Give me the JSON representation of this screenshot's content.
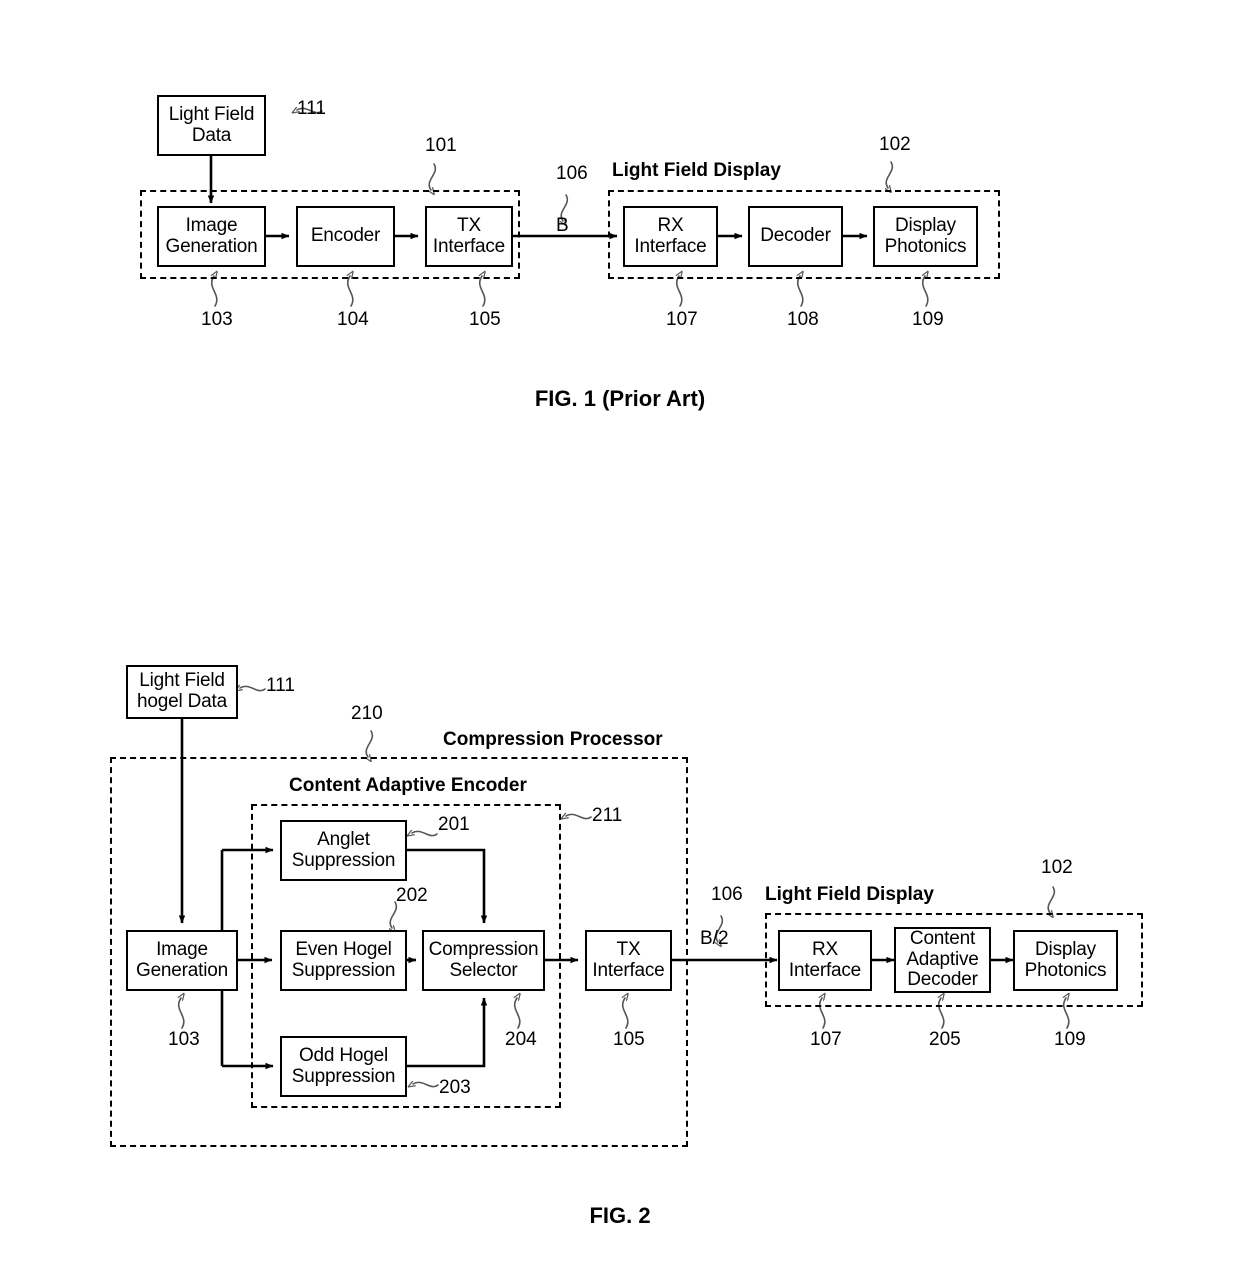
{
  "document": {
    "type": "patent-figure-sheet",
    "figures": [
      {
        "caption": "FIG. 1 (Prior Art)",
        "groups": [
          {
            "label": "",
            "ref": "101"
          },
          {
            "label": "Light Field Display",
            "ref": "102"
          }
        ],
        "blocks": [
          {
            "label": "Light Field\nData",
            "ref": "111"
          },
          {
            "label": "Image\nGeneration",
            "ref": "103"
          },
          {
            "label": "Encoder",
            "ref": "104"
          },
          {
            "label": "TX\nInterface",
            "ref": "105"
          },
          {
            "label": "RX\nInterface",
            "ref": "107"
          },
          {
            "label": "Decoder",
            "ref": "108"
          },
          {
            "label": "Display\nPhotonics",
            "ref": "109"
          }
        ],
        "signals": [
          {
            "label": "B",
            "ref": "106"
          }
        ]
      },
      {
        "caption": "FIG. 2",
        "groups": [
          {
            "label": "Compression Processor",
            "ref": "210"
          },
          {
            "label": "Content Adaptive Encoder",
            "ref": "211"
          },
          {
            "label": "Light Field Display",
            "ref": "102"
          }
        ],
        "blocks": [
          {
            "label": "Light Field\nhogel Data",
            "ref": "111"
          },
          {
            "label": "Image\nGeneration",
            "ref": "103"
          },
          {
            "label": "Anglet\nSuppression",
            "ref": "201"
          },
          {
            "label": "Even Hogel\nSuppression",
            "ref": "202"
          },
          {
            "label": "Odd Hogel\nSuppression",
            "ref": "203"
          },
          {
            "label": "Compression\nSelector",
            "ref": "204"
          },
          {
            "label": "TX\nInterface",
            "ref": "105"
          },
          {
            "label": "RX\nInterface",
            "ref": "107"
          },
          {
            "label": "Content\nAdaptive\nDecoder",
            "ref": "205"
          },
          {
            "label": "Display\nPhotonics",
            "ref": "109"
          }
        ],
        "signals": [
          {
            "label": "B/2",
            "ref": "106"
          }
        ]
      }
    ]
  },
  "fig1": {
    "caption": "FIG. 1 (Prior Art)",
    "group_label_display": "Light Field Display",
    "source_box": "Light Field\nData",
    "blocks": {
      "image_generation": "Image\nGeneration",
      "encoder": "Encoder",
      "tx_interface": "TX\nInterface",
      "rx_interface": "RX\nInterface",
      "decoder": "Decoder",
      "display_photonics": "Display\nPhotonics"
    },
    "signal_b": "B",
    "refs": {
      "source": "111",
      "transmitter_group": "101",
      "display_group": "102",
      "image_generation": "103",
      "encoder": "104",
      "tx_interface": "105",
      "link": "106",
      "rx_interface": "107",
      "decoder": "108",
      "display_photonics": "109"
    }
  },
  "fig2": {
    "caption": "FIG. 2",
    "group_labels": {
      "compression_processor": "Compression Processor",
      "content_adaptive_encoder": "Content Adaptive Encoder",
      "light_field_display": "Light Field Display"
    },
    "source_box": "Light Field\nhogel Data",
    "blocks": {
      "image_generation": "Image\nGeneration",
      "anglet_suppression": "Anglet\nSuppression",
      "even_hogel_suppression": "Even Hogel\nSuppression",
      "odd_hogel_suppression": "Odd Hogel\nSuppression",
      "compression_selector": "Compression\nSelector",
      "tx_interface": "TX\nInterface",
      "rx_interface": "RX\nInterface",
      "content_adaptive_decoder": "Content\nAdaptive\nDecoder",
      "display_photonics": "Display\nPhotonics"
    },
    "signal_b2": "B/2",
    "refs": {
      "source": "111",
      "compression_processor": "210",
      "content_adaptive_encoder": "211",
      "image_generation": "103",
      "anglet_suppression": "201",
      "even_hogel_suppression": "202",
      "odd_hogel_suppression": "203",
      "compression_selector": "204",
      "tx_interface": "105",
      "link": "106",
      "display_group": "102",
      "rx_interface": "107",
      "content_adaptive_decoder": "205",
      "display_photonics": "109"
    }
  },
  "colors": {
    "ink": "#000000",
    "paper": "#ffffff",
    "leader": "#555555"
  }
}
